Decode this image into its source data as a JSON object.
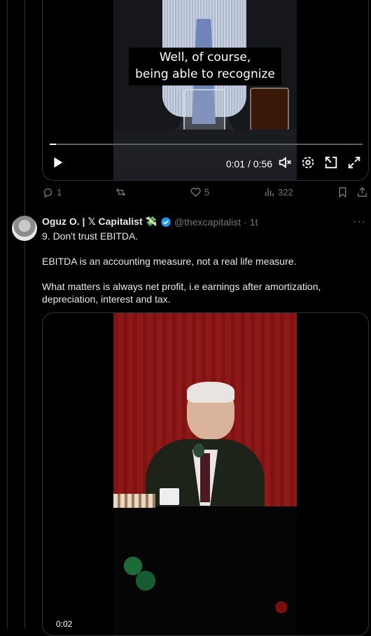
{
  "tweet1": {
    "video": {
      "caption_line1": "Well, of course,",
      "caption_line2": "being able to recognize",
      "time": "0:01 / 0:56",
      "progress": 0.02
    },
    "actions": {
      "replies": "1",
      "reposts": "",
      "likes": "5",
      "views": "322"
    }
  },
  "tweet2": {
    "display_name": "Oguz O. | 𝕏 Capitalist 💸",
    "handle": "@thexcapitalist",
    "separator": "·",
    "time": "1t",
    "more": "···",
    "paragraphs": [
      "9. Don't trust EBITDA.",
      "EBITDA is an accounting measure, not a real life measure.",
      "What matters is always net profit, i.e earnings after amortization, depreciation, interest and tax."
    ],
    "video": {
      "time": "0:02"
    }
  },
  "icons": {
    "play": "play-icon",
    "mute": "muted-speaker-icon",
    "settings": "gear-icon",
    "pip": "picture-in-picture-icon",
    "fullscreen": "fullscreen-icon",
    "reply": "reply-icon",
    "repost": "repost-icon",
    "like": "heart-icon",
    "views": "views-icon",
    "bookmark": "bookmark-icon",
    "share": "share-icon",
    "verified": "verified-badge-icon"
  },
  "colors": {
    "background": "#000000",
    "muted": "#71767b",
    "verified": "#1d9bf0",
    "text": "#e7e9ea"
  }
}
